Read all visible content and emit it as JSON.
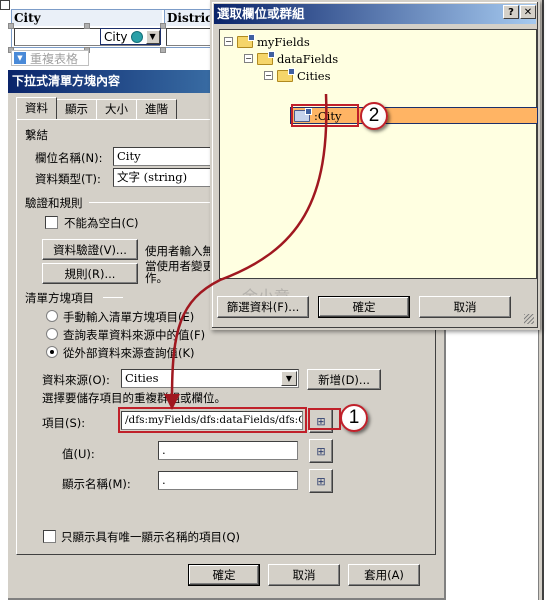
{
  "form": {
    "columns": [
      "City",
      "District"
    ],
    "control_tag": "City",
    "repeat_table_label": "重複表格"
  },
  "pane": {
    "title": "下拉式清單方塊內容",
    "tabs": [
      {
        "label": "資料",
        "active": true
      },
      {
        "label": "顯示",
        "active": false
      },
      {
        "label": "大小",
        "active": false
      },
      {
        "label": "進階",
        "active": false
      }
    ],
    "binding": {
      "section_label": "繫結",
      "field_name_label": "欄位名稱(N):",
      "field_name_value": "City",
      "data_type_label": "資料類型(T):",
      "data_type_value": "文字 (string)"
    },
    "validation": {
      "section_label": "驗證和規則",
      "cannot_be_blank_label": "不能為空白(C)",
      "cannot_be_blank_checked": false,
      "data_validation_button": "資料驗證(V)...",
      "data_validation_desc": "使用者輸入無",
      "rules_button": "規則(R)...",
      "rules_desc_line1": "當使用者變更",
      "rules_desc_line2": "作。"
    },
    "list_items": {
      "section_label": "清單方塊項目",
      "options": [
        {
          "label": "手動輸入清單方塊項目(E)",
          "selected": false
        },
        {
          "label": "查詢表單資料來源中的值(F)",
          "selected": false
        },
        {
          "label": "從外部資料來源查詢值(K)",
          "selected": true
        }
      ],
      "data_source_label": "資料來源(O):",
      "data_source_value": "Cities",
      "add_button": "新增(D)...",
      "choose_group_text": "選擇要儲存項目的重複群組或欄位。",
      "entries_label": "項目(S):",
      "entries_value": "/dfs:myFields/dfs:dataFields/dfs:Cities",
      "value_label": "值(U):",
      "value_value": ".",
      "display_name_label": "顯示名稱(M):",
      "display_name_value": ".",
      "unique_only_label": "只顯示具有唯一顯示名稱的項目(Q)",
      "unique_only_checked": false
    },
    "buttons": {
      "ok": "確定",
      "cancel": "取消",
      "apply": "套用(A)"
    }
  },
  "dialog": {
    "title": "選取欄位或群組",
    "help_glyph": "?",
    "close_glyph": "✕",
    "tree": [
      {
        "label": "myFields",
        "expanded": true
      },
      {
        "label": "dataFields",
        "expanded": true
      },
      {
        "label": "Cities",
        "expanded": true
      },
      {
        "label": ":City",
        "selected": true
      }
    ],
    "buttons": {
      "filter": "篩選資料(F)...",
      "ok": "確定",
      "cancel": "取消"
    },
    "watermark": "余小章"
  },
  "annotations": {
    "callout_1": "1",
    "callout_2": "2"
  },
  "colors": {
    "selection": "#ffb464",
    "highlight": "#c0202a",
    "title_bar": "#0a246a",
    "tree_bg": "#ffffe1"
  }
}
